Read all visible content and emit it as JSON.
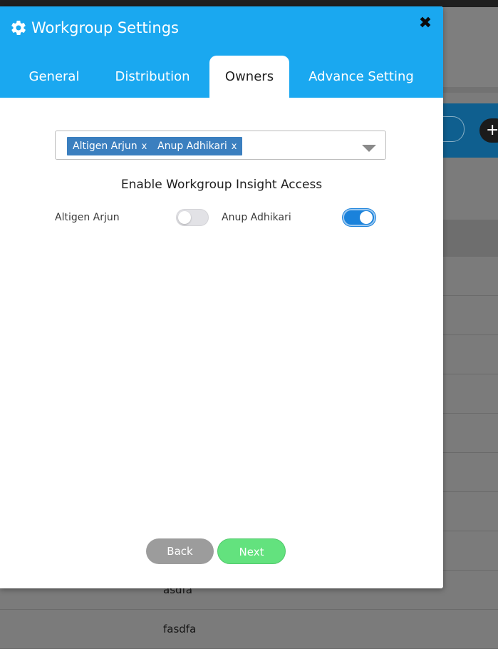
{
  "modal": {
    "title": "Workgroup Settings",
    "icon": "gear-icon",
    "close_label": "✖",
    "tabs": [
      {
        "label": "General",
        "active": false
      },
      {
        "label": "Distribution",
        "active": false
      },
      {
        "label": "Owners",
        "active": true
      },
      {
        "label": "Advance Setting",
        "active": false
      }
    ]
  },
  "owners": {
    "selected": [
      {
        "name": "Altigen Arjun",
        "remove": "x"
      },
      {
        "name": "Anup Adhikari",
        "remove": "x"
      }
    ],
    "section_title": "Enable Workgroup Insight Access",
    "access": [
      {
        "name": "Altigen Arjun",
        "enabled": false
      },
      {
        "name": "Anup Adhikari",
        "enabled": true
      }
    ]
  },
  "buttons": {
    "back": "Back",
    "next": "Next"
  },
  "background": {
    "rows": [
      "asdfa",
      "fasdfa"
    ]
  },
  "colors": {
    "header": "#1aa8f0",
    "chip": "#3b7fbf",
    "toggle_on": "#1a82db",
    "back_button": "#9c9c9c",
    "next_button": "#63e27e"
  }
}
